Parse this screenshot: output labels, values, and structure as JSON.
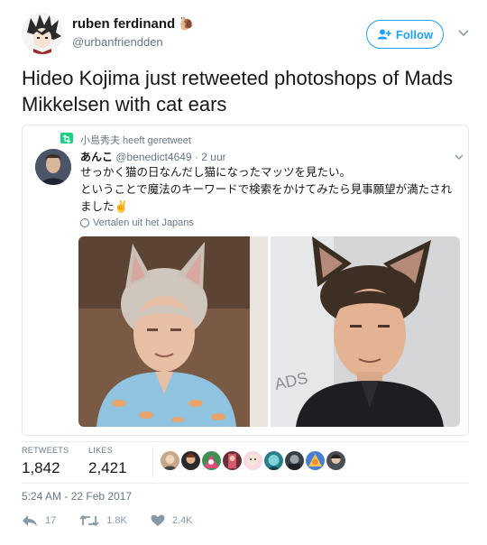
{
  "author": {
    "name": "ruben ferdinand",
    "handle": "@urbanfriendden",
    "emoji": "🐌"
  },
  "follow_label": "Follow",
  "tweet_text": "Hideo Kojima just retweeted photoshops of Mads Mikkelsen with cat ears",
  "quote": {
    "retweet_notice": "小島秀夫 heeft geretweet",
    "author_name": "あんこ",
    "author_handle": "@benedict4649",
    "time": "· 2 uur",
    "text": "せっかく猫の日なんだし猫になったマッツを見たい。\nということで魔法のキーワードで検索をかけてみたら見事願望が満たされました✌",
    "translate_label": "Vertalen uit het Japans"
  },
  "stats": {
    "retweets_label": "RETWEETS",
    "retweets_value": "1,842",
    "likes_label": "LIKES",
    "likes_value": "2,421"
  },
  "timestamp": "5:24 AM - 22 Feb 2017",
  "actions": {
    "reply_count": "17",
    "retweet_count": "1.8K",
    "like_count": "2.4K"
  },
  "colors": {
    "accent": "#1da1f2",
    "retweet_green": "#19cf86",
    "muted": "#657786"
  },
  "icons": [
    "add-user-icon",
    "chevron-down-icon",
    "retweet-icon",
    "globe-icon",
    "reply-icon",
    "heart-icon"
  ]
}
